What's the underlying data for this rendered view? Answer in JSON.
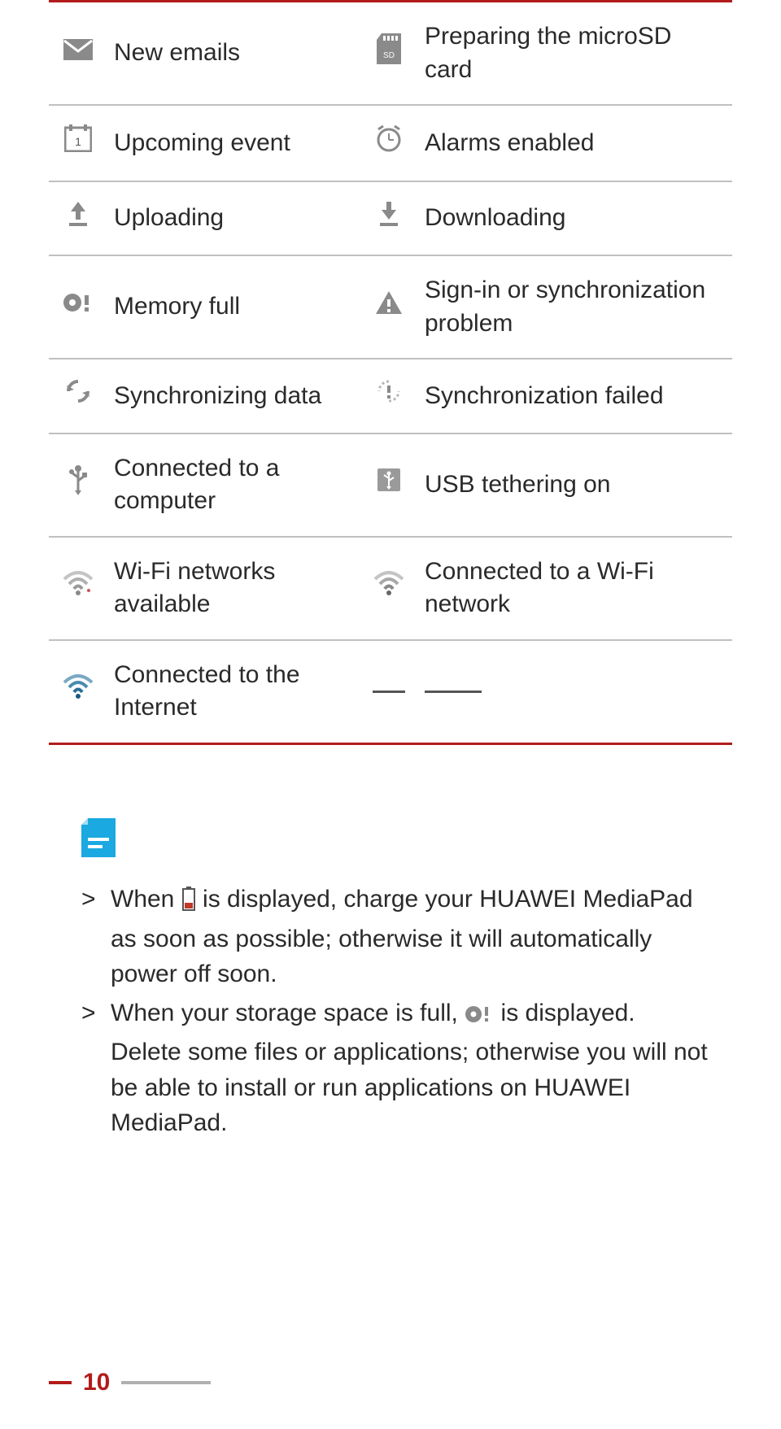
{
  "icons": {
    "rows": [
      {
        "left_icon": "email-icon",
        "left_label": "New emails",
        "right_icon": "sd-card-icon",
        "right_label": "Preparing the microSD card"
      },
      {
        "left_icon": "calendar-icon",
        "left_label": "Upcoming event",
        "right_icon": "alarm-icon",
        "right_label": "Alarms enabled"
      },
      {
        "left_icon": "upload-icon",
        "left_label": "Uploading",
        "right_icon": "download-icon",
        "right_label": "Downloading"
      },
      {
        "left_icon": "memory-full-icon",
        "left_label": "Memory full",
        "right_icon": "warning-icon",
        "right_label": "Sign-in or synchronization problem"
      },
      {
        "left_icon": "sync-icon",
        "left_label": "Synchronizing data",
        "right_icon": "sync-failed-icon",
        "right_label": "Synchronization failed"
      },
      {
        "left_icon": "usb-icon",
        "left_label": "Connected to a computer",
        "right_icon": "usb-tether-icon",
        "right_label": "USB tethering on"
      },
      {
        "left_icon": "wifi-available-icon",
        "left_label": "Wi-Fi networks available",
        "right_icon": "wifi-connected-icon",
        "right_label": "Connected to a Wi-Fi network"
      },
      {
        "left_icon": "internet-icon",
        "left_label": "Connected to the Internet",
        "right_icon": "blank-icon",
        "right_label": ""
      }
    ]
  },
  "notes": {
    "item1_pre": "When ",
    "item1_post": " is displayed, charge your HUAWEI MediaPad as soon as possible; otherwise it will automatically power off soon.",
    "item2_pre": "When your storage space is full, ",
    "item2_post": " is displayed. Delete some files or applications; otherwise you will not be able to install or run applications on HUAWEI MediaPad."
  },
  "page_number": "10"
}
